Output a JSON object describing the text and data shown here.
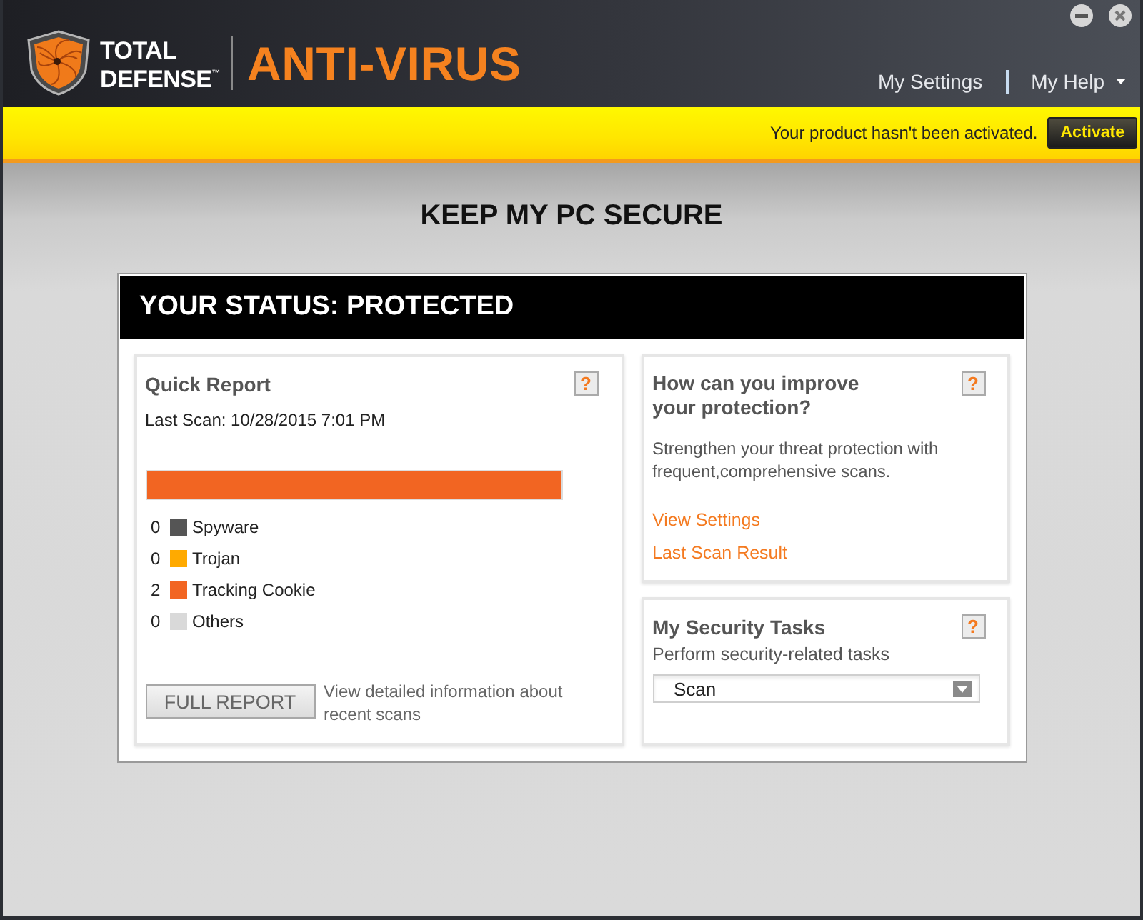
{
  "header": {
    "brand": "TOTAL DEFENSE$^{™}$",
    "product": "ANTI-VIRUS",
    "nav": [
      {
        "label": "My Settings",
        "kind": "link"
      },
      {
        "label": "My Help",
        "kind": "menu"
      }
    ]
  },
  "activation_bar": {
    "message": "Your product hasn't been activated.",
    "button": "Activate"
  },
  "page_title": "KEEP MY PC SECURE",
  "status_title": "YOUR STATUS: PROTECTED",
  "quick_report": {
    "title": "Quick Report",
    "help": "?",
    "last_scan": "Last Scan: 10/28/2015 7:01 PM",
    "legend": [
      {
        "count": "0",
        "label": "Spyware",
        "color": "#555555"
      },
      {
        "count": "0",
        "label": "Trojan",
        "color": "#ffaa00"
      },
      {
        "count": "2",
        "label": "Tracking Cookie",
        "color": "#f26522"
      },
      {
        "count": "0",
        "label": "Others",
        "color": "#d9d9d9"
      }
    ],
    "button": "FULL REPORT",
    "note": "View detailed information about recent scans"
  },
  "improve_panel": {
    "title": "How can you improve your protection?",
    "help": "?",
    "text": "Strengthen your threat protection with frequent,comprehensive scans.",
    "links": [
      "View Settings",
      "Last Scan Result"
    ]
  },
  "tasks_panel": {
    "title": "My Security Tasks",
    "help": "?",
    "subtitle": "Perform security-related tasks",
    "select": {
      "value": "Scan"
    }
  }
}
